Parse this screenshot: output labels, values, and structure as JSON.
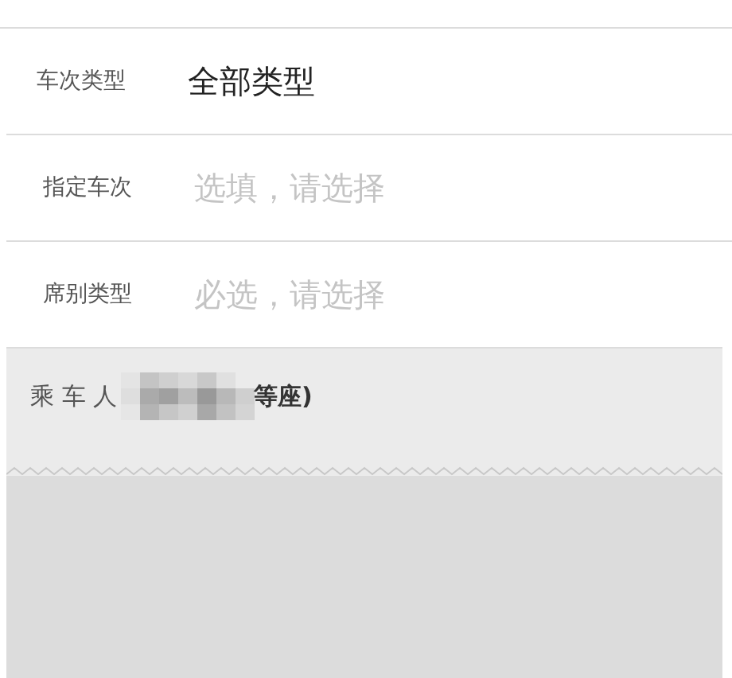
{
  "form_rows": [
    {
      "label": "车次类型",
      "value": "全部类型"
    },
    {
      "label": "指定车次",
      "placeholder": "选填，请选择"
    },
    {
      "label": "席别类型",
      "placeholder": "必选，请选择"
    }
  ],
  "passenger": {
    "label": "乘 车 人",
    "detail_suffix": "等座)"
  }
}
